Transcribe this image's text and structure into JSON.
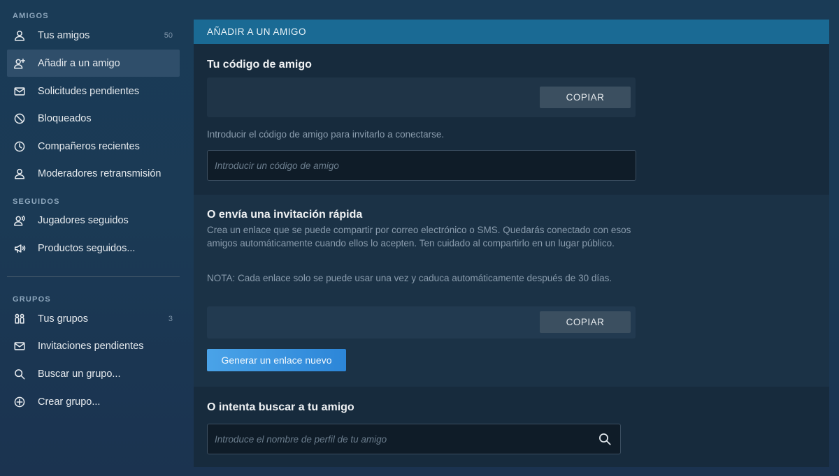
{
  "sidebar": {
    "sections": {
      "friends": "AMIGOS",
      "following": "SEGUIDOS",
      "groups": "GRUPOS"
    },
    "friends_items": [
      {
        "label": "Tus amigos",
        "count": "50",
        "icon": "person-icon"
      },
      {
        "label": "Añadir a un amigo",
        "icon": "add-person-icon",
        "active": true
      },
      {
        "label": "Solicitudes pendientes",
        "icon": "envelope-icon"
      },
      {
        "label": "Bloqueados",
        "icon": "blocked-icon"
      },
      {
        "label": "Compañeros recientes",
        "icon": "clock-icon"
      },
      {
        "label": "Moderadores retransmisión",
        "icon": "person-icon"
      }
    ],
    "following_items": [
      {
        "label": "Jugadores seguidos",
        "icon": "followed-person-icon"
      },
      {
        "label": "Productos seguidos...",
        "icon": "megaphone-icon"
      }
    ],
    "groups_items": [
      {
        "label": "Tus grupos",
        "count": "3",
        "icon": "group-icon"
      },
      {
        "label": "Invitaciones pendientes",
        "icon": "envelope-icon"
      },
      {
        "label": "Buscar un grupo...",
        "icon": "search-icon"
      },
      {
        "label": "Crear grupo...",
        "icon": "plus-circle-icon"
      }
    ]
  },
  "panel": {
    "header": "AÑADIR A UN AMIGO",
    "friend_code": {
      "title": "Tu código de amigo",
      "copy_label": "COPIAR",
      "hint": "Introducir el código de amigo para invitarlo a conectarse.",
      "input_placeholder": "Introducir un código de amigo"
    },
    "quick_invite": {
      "title": "O envía una invitación rápida",
      "description": "Crea un enlace que se puede compartir por correo electrónico o SMS. Quedarás conectado con esos amigos automáticamente cuando ellos lo acepten. Ten cuidado al compartirlo en un lugar público.",
      "note": "NOTA: Cada enlace solo se puede usar una vez y caduca automáticamente después de 30 días.",
      "copy_label": "COPIAR",
      "generate_label": "Generar un enlace nuevo"
    },
    "search": {
      "title": "O intenta buscar a tu amigo",
      "placeholder": "Introduce el nombre de perfil de tu amigo"
    }
  }
}
